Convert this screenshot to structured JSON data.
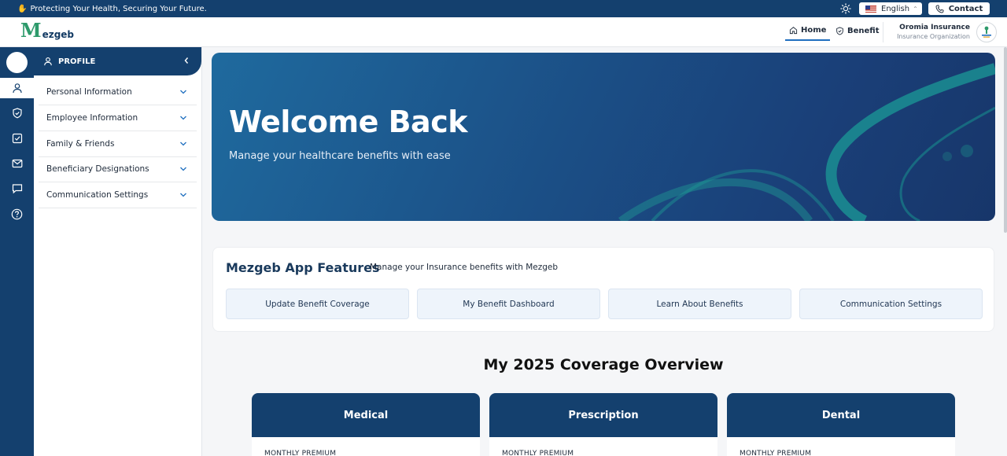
{
  "topbar": {
    "hand_icon": "✋",
    "tagline": "Protecting Your Health, Securing Your Future.",
    "language": "English",
    "language_caret": "⌃",
    "contact_label": "Contact"
  },
  "header": {
    "logo_m": "M",
    "logo_rest": "ezgeb",
    "nav": [
      {
        "label": "Home",
        "active": true
      },
      {
        "label": "Benefit",
        "active": false
      }
    ],
    "org_name": "Oromia Insurance",
    "org_type": "Insurance Organization"
  },
  "rail": {
    "icons": [
      "user-icon",
      "shield-check-icon",
      "checkbox-icon",
      "mail-icon",
      "message-icon",
      "help-icon"
    ],
    "active_index": 0
  },
  "profile": {
    "title": "PROFILE",
    "sections": [
      "Personal Information",
      "Employee Information",
      "Family & Friends",
      "Beneficiary Designations",
      "Communication Settings"
    ]
  },
  "hero": {
    "title": "Welcome Back",
    "subtitle": "Manage your healthcare benefits with ease"
  },
  "features": {
    "title": "Mezgeb App Features",
    "subtitle": "Manage your Insurance benefits with Mezgeb",
    "buttons": [
      "Update Benefit Coverage",
      "My Benefit Dashboard",
      "Learn About Benefits",
      "Communication Settings"
    ]
  },
  "overview": {
    "title": "My 2025 Coverage Overview",
    "cards": [
      {
        "title": "Medical",
        "label": "MONTHLY PREMIUM"
      },
      {
        "title": "Prescription",
        "label": "MONTHLY PREMIUM"
      },
      {
        "title": "Dental",
        "label": "MONTHLY PREMIUM"
      }
    ]
  },
  "colors": {
    "navy": "#14406e",
    "accent": "#1f6fbf",
    "brand_green": "#2d9a6b",
    "button_bg": "#eef4fb"
  }
}
